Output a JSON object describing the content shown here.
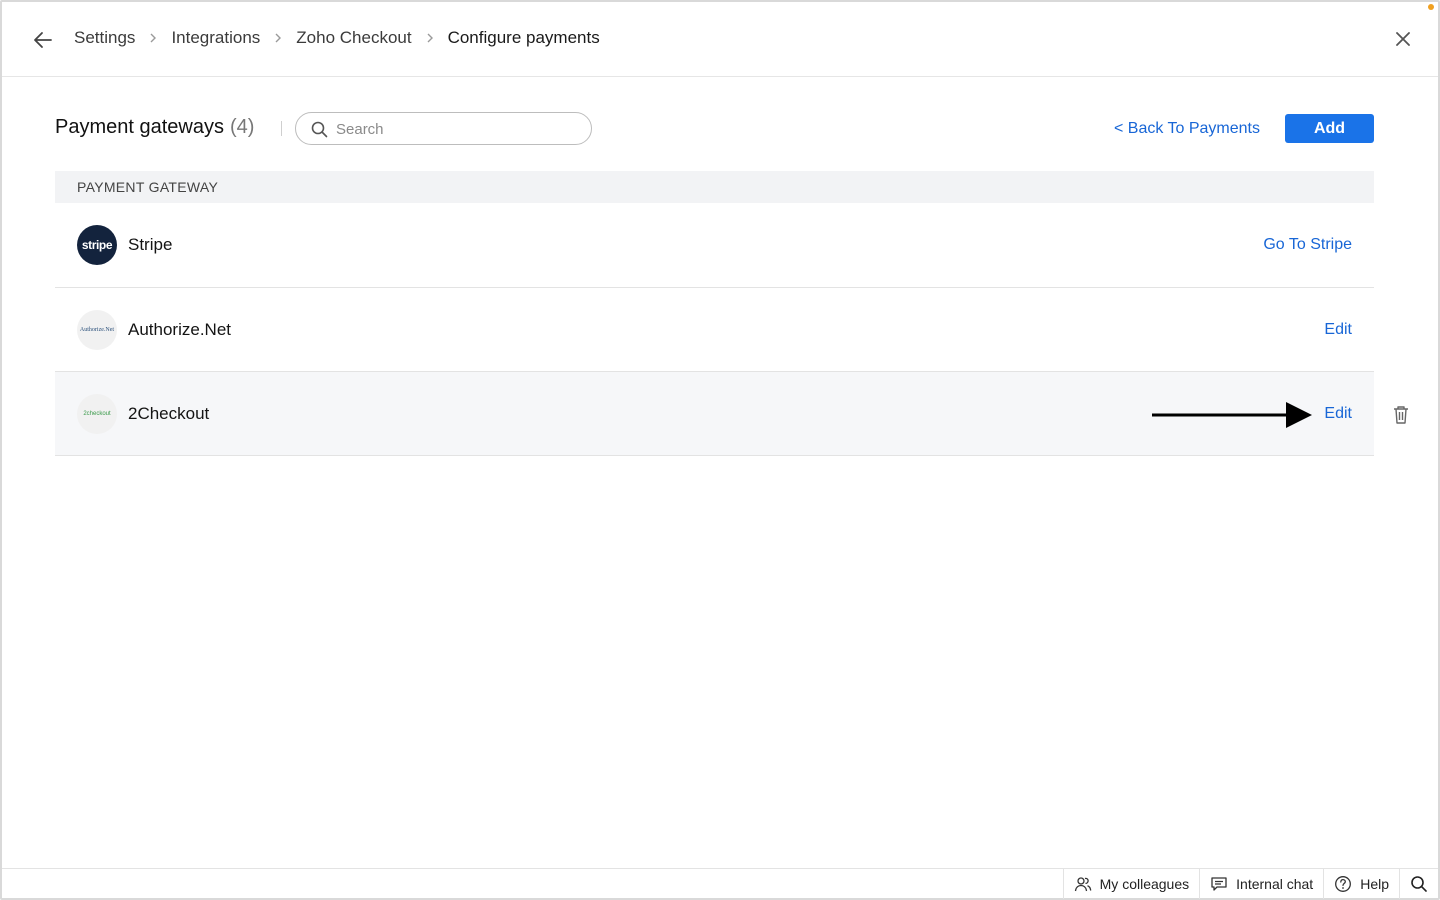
{
  "header": {
    "breadcrumb": [
      "Settings",
      "Integrations",
      "Zoho Checkout",
      "Configure payments"
    ]
  },
  "toolbar": {
    "title": "Payment gateways",
    "count": "(4)",
    "search_placeholder": "Search",
    "back_link": "< Back To Payments",
    "add_label": "Add"
  },
  "table": {
    "column_header": "PAYMENT GATEWAY",
    "rows": [
      {
        "name": "Stripe",
        "logo_text": "stripe",
        "action": "Go To Stripe"
      },
      {
        "name": "Authorize.Net",
        "logo_text": "Authorize.Net",
        "action": "Edit"
      },
      {
        "name": "2Checkout",
        "logo_text": "2checkout",
        "action": "Edit"
      }
    ]
  },
  "footer": {
    "colleagues": "My colleagues",
    "chat": "Internal chat",
    "help": "Help"
  },
  "colors": {
    "accent": "#1a73e8",
    "link": "#1866d6",
    "stripe_logo_bg": "#13233d",
    "notification_dot": "#f0a020"
  }
}
